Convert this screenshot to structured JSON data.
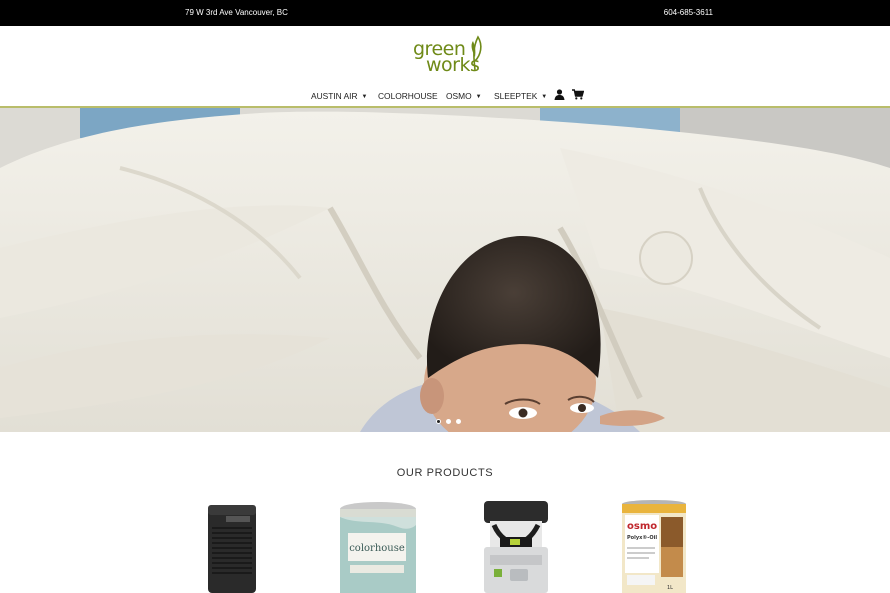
{
  "topbar": {
    "address": "79 W 3rd Ave Vancouver, BC",
    "phone": "604-685-3611"
  },
  "logo": {
    "line1": "green",
    "line2": "works",
    "color": "#6f8a18"
  },
  "nav": {
    "items": [
      {
        "label": "AUSTIN AIR",
        "has_dropdown": true
      },
      {
        "label": "COLORHOUSE",
        "has_dropdown": false
      },
      {
        "label": "OSMO",
        "has_dropdown": true
      },
      {
        "label": "SLEEPTEK",
        "has_dropdown": true
      }
    ],
    "caret": "▼",
    "icons": [
      "account-icon",
      "cart-icon"
    ]
  },
  "hero": {
    "slide_count": 3,
    "active_slide": 1
  },
  "products": {
    "title": "OUR PRODUCTS",
    "items": [
      {
        "icon": "air-purifier-image"
      },
      {
        "icon": "colorhouse-paint-can-image",
        "brand_text": "colorhouse"
      },
      {
        "icon": "dust-extractor-image"
      },
      {
        "icon": "osmo-oil-can-image",
        "brand_text": "osmo",
        "product_text": "Polyx®-Oil",
        "size_text": "1L"
      }
    ]
  },
  "colors": {
    "topbar": "#000000",
    "accent_line": "#b9bd6a",
    "brand_green": "#6f8a18"
  }
}
